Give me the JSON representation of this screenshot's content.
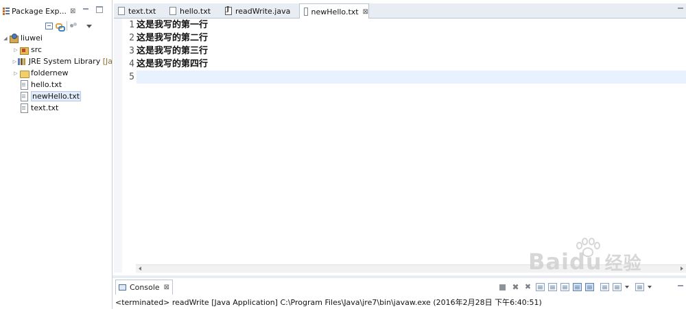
{
  "explorer": {
    "title": "Package Exp...",
    "close": "⊠",
    "tree": [
      {
        "label": "liuwei",
        "icon": "java-project-icon",
        "twisty": "◢",
        "indent": 0
      },
      {
        "label": "src",
        "icon": "package-folder-icon",
        "twisty": "▷",
        "indent": 1
      },
      {
        "label": "JRE System Library",
        "decoration": "[Ja",
        "icon": "library-icon",
        "twisty": "▷",
        "indent": 1
      },
      {
        "label": "foldernew",
        "icon": "folder-icon",
        "twisty": "▷",
        "indent": 1
      },
      {
        "label": "hello.txt",
        "icon": "text-file-icon",
        "twisty": "",
        "indent": 1
      },
      {
        "label": "newHello.txt",
        "icon": "text-file-icon",
        "twisty": "",
        "indent": 1,
        "selected": true
      },
      {
        "label": "text.txt",
        "icon": "text-file-icon",
        "twisty": "",
        "indent": 1
      }
    ]
  },
  "editor": {
    "tabs": [
      {
        "label": "text.txt",
        "icon": "text-file-icon"
      },
      {
        "label": "hello.txt",
        "icon": "text-file-icon"
      },
      {
        "label": "readWrite.java",
        "icon": "java-file-icon"
      },
      {
        "label": "newHello.txt",
        "icon": "text-file-icon",
        "active": true,
        "close": "⊠"
      }
    ],
    "line_numbers": [
      "1",
      "2",
      "3",
      "4",
      "5"
    ],
    "lines": [
      "这是我写的第一行",
      "这是我写的第二行",
      "这是我写的第三行",
      "这是我写的第四行",
      ""
    ],
    "current_line": 5
  },
  "console": {
    "tab_label": "Console",
    "close": "⊠",
    "status": "<terminated> readWrite [Java Application] C:\\Program Files\\Java\\jre7\\bin\\javaw.exe (2016年2月28日 下午6:40:51)",
    "toolbar": [
      "terminate-icon",
      "remove-launch-icon",
      "remove-all-icon",
      "scroll-lock-icon",
      "show-on-stdout-icon",
      "show-on-stderr-icon",
      "word-wrap-icon",
      "pin-console-icon",
      "display-console-icon",
      "open-console-icon"
    ]
  },
  "watermark": {
    "text": "Bai",
    "text2": "du",
    "cn": "经验"
  }
}
